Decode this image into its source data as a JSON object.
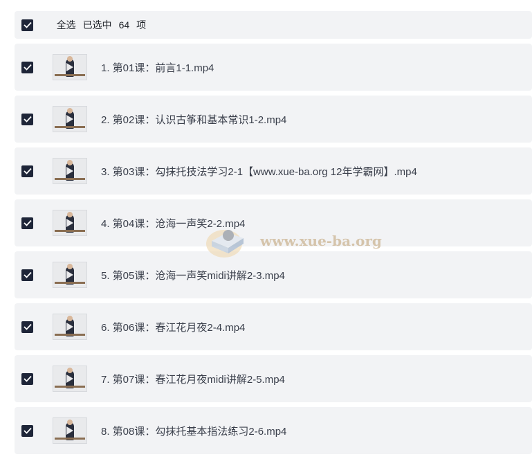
{
  "header": {
    "select_all_label": "全选",
    "selected_prefix": "已选中",
    "selected_count": "64",
    "selected_suffix": "项"
  },
  "files": [
    {
      "name": "1. 第01课：前言1-1.mp4"
    },
    {
      "name": "2. 第02课：认识古筝和基本常识1-2.mp4"
    },
    {
      "name": "3. 第03课：勾抹托技法学习2-1【www.xue-ba.org 12年学霸网】.mp4"
    },
    {
      "name": "4. 第04课：沧海一声笑2-2.mp4"
    },
    {
      "name": "5. 第05课：沧海一声笑midi讲解2-3.mp4"
    },
    {
      "name": "6. 第06课：春江花月夜2-4.mp4"
    },
    {
      "name": "7. 第07课：春江花月夜midi讲解2-5.mp4"
    },
    {
      "name": "8. 第08课：勾抹托基本指法练习2-6.mp4"
    }
  ],
  "watermark": {
    "text": "www.xue-ba.org"
  },
  "colors": {
    "row_background": "#f2f3f5",
    "checkbox_checked": "#1e2538",
    "text": "#3a3f4b"
  },
  "icons": {
    "checkbox": "checkmark-icon",
    "thumbnail": "video-thumbnail"
  }
}
